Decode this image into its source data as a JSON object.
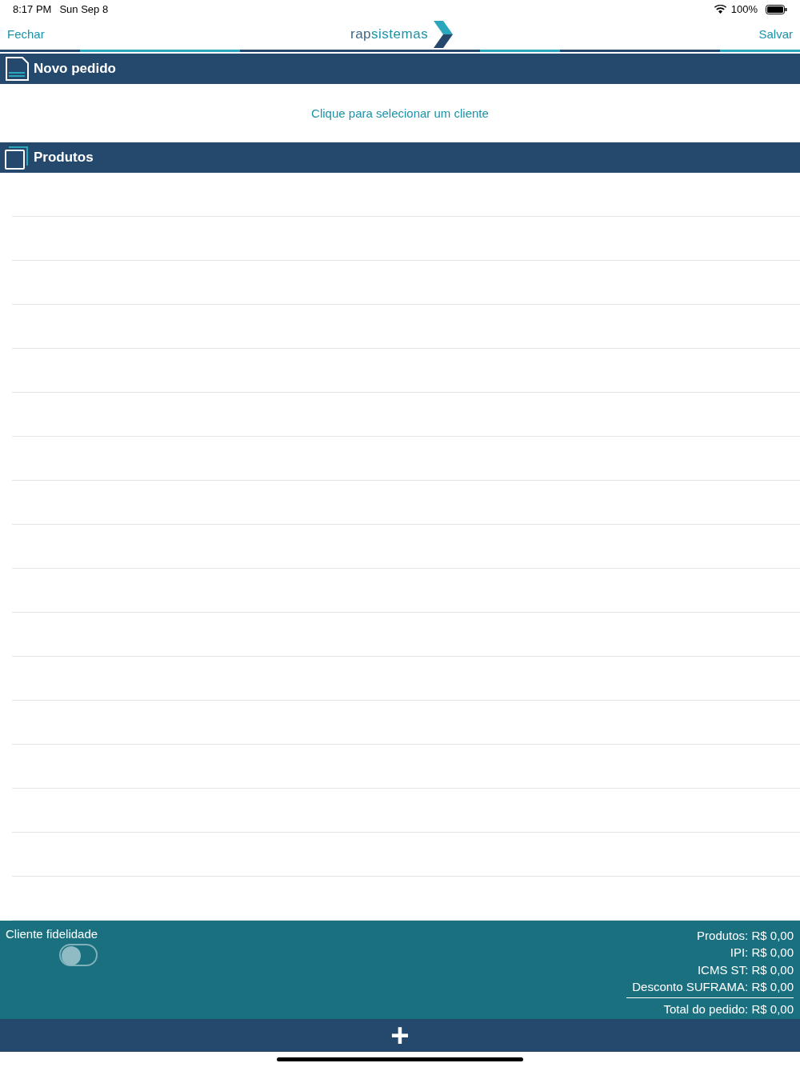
{
  "status_bar": {
    "time": "8:17 PM",
    "date": "Sun Sep 8",
    "battery": "100%"
  },
  "nav": {
    "left": "Fechar",
    "logo_parts": [
      "rap",
      "sistemas"
    ],
    "right": "Salvar"
  },
  "order_header": {
    "title": "Novo pedido"
  },
  "client_prompt": "Clique para selecionar um cliente",
  "products_header": {
    "title": "Produtos"
  },
  "footer": {
    "loyalty_label": "Cliente fidelidade",
    "loyalty_on": false,
    "totals": [
      "Produtos: R$ 0,00",
      "IPI: R$ 0,00",
      "ICMS ST: R$ 0,00",
      "Desconto SUFRAMA: R$ 0,00"
    ],
    "grand_total": "Total do pedido: R$ 0,00"
  },
  "add_button": "+"
}
